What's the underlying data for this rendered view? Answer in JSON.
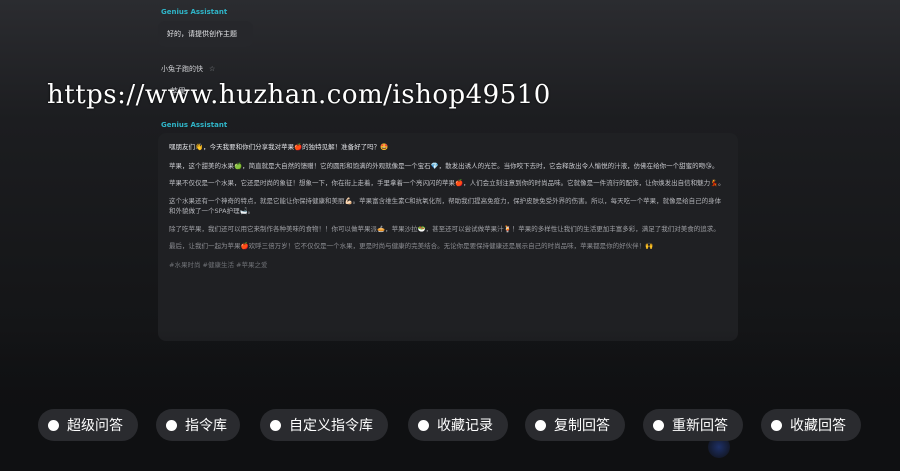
{
  "chat": {
    "assistant_name": "Genius Assistant",
    "reply_1": "好的，请提供创作主题",
    "user_name": "小兔子跑的快",
    "user_star": "☆",
    "user_message": "苹果",
    "reply_2": {
      "paragraphs": [
        "嘿朋友们👋，今天我要和你们分享我对苹果🍎的独特见解！准备好了吗？🤩",
        "苹果，这个甜美的水果🍏，简直就是大自然的馈赠！它的圆形和饱满的外观就像是一个宝石💎，散发出诱人的光芒。当你咬下去时，它会释放出令人愉悦的汁液，仿佛在给你一个甜蜜的吻😘。",
        "苹果不仅仅是一个水果，它还是时尚的象征！想象一下，你在街上走着，手里拿着一个亮闪闪的苹果🍎，人们会立刻注意到你的时尚品味。它就像是一件流行的配饰，让你焕发出自信和魅力💃。",
        "这个水果还有一个神奇的特点，就是它能让你保持健康和美丽💪🏻。苹果富含维生素C和抗氧化剂，帮助我们提高免疫力，保护皮肤免受外界的伤害。所以，每天吃一个苹果，就像是给自己的身体和外貌做了一个SPA护理🛁。",
        "除了吃苹果，我们还可以用它来制作各种美味的食物！！你可以做苹果派🥧，苹果沙拉🥗，甚至还可以尝试做苹果汁🍹！苹果的多样性让我们的生活更加丰富多彩，满足了我们对美食的追求。",
        "最后，让我们一起为苹果🍎欢呼三倍万岁！它不仅仅是一个水果，更是时尚与健康的完美结合。无论你是要保持健康还是展示自己的时尚品味，苹果都是你的好伙伴！🙌"
      ],
      "tags": "#水果时尚 #健康生活 #苹果之爱"
    }
  },
  "watermark": "https://www.huzhan.com/ishop49510",
  "actions": [
    {
      "label": "超级问答"
    },
    {
      "label": "指令库"
    },
    {
      "label": "自定义指令库"
    },
    {
      "label": "收藏记录"
    },
    {
      "label": "复制回答"
    },
    {
      "label": "重新回答"
    },
    {
      "label": "收藏回答"
    }
  ],
  "colors": {
    "accent": "#2fb4c7",
    "background": "#151618",
    "pill": "#2a2b2f"
  }
}
